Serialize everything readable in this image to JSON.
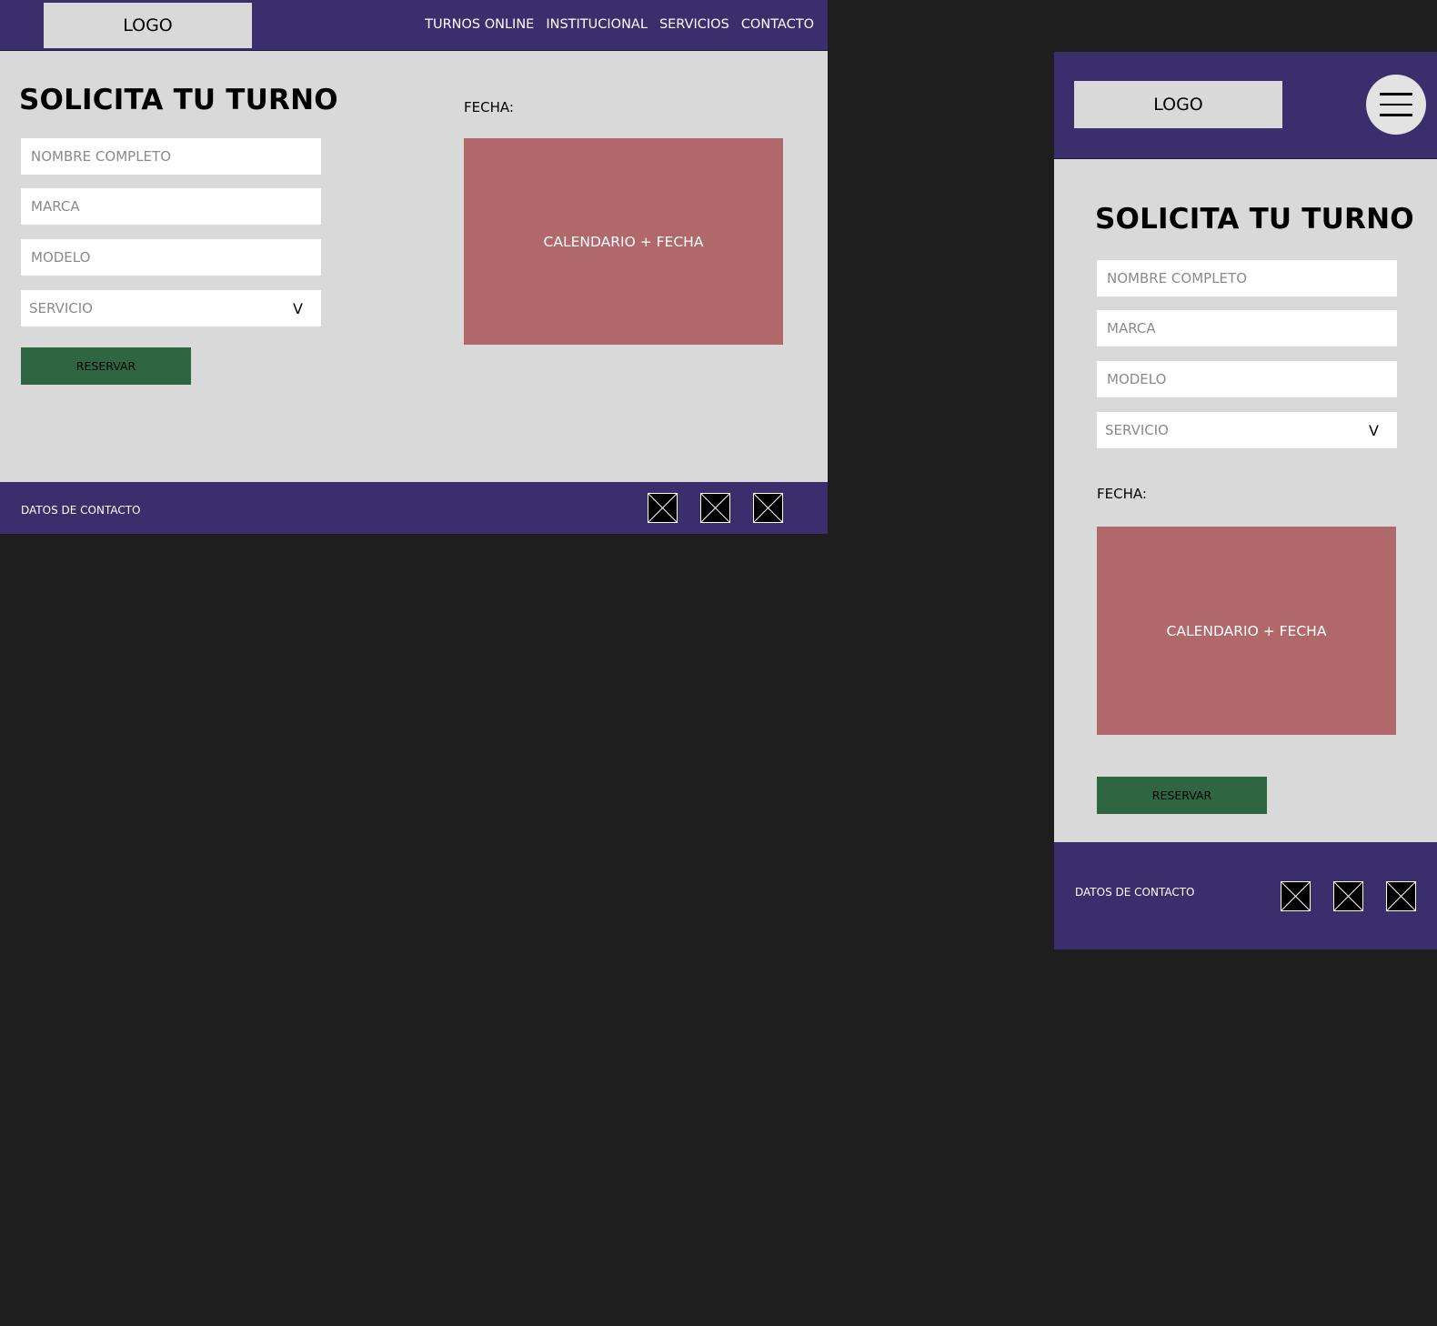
{
  "desktop": {
    "logo": "LOGO",
    "nav": [
      {
        "label": "TURNOS ONLINE"
      },
      {
        "label": "INSTITUCIONAL"
      },
      {
        "label": "SERVICIOS"
      },
      {
        "label": "CONTACTO"
      }
    ],
    "title": "SOLICITA TU TURNO",
    "fields": {
      "nombre_placeholder": "NOMBRE COMPLETO",
      "marca_placeholder": "MARCA",
      "modelo_placeholder": "MODELO"
    },
    "servicio": {
      "placeholder": "SERVICIO",
      "chevron": "V"
    },
    "reservar_label": "RESERVAR",
    "fecha_label": "FECHA:",
    "calendar_label": "CALENDARIO + FECHA",
    "footer": {
      "contact": "DATOS DE CONTACTO"
    }
  },
  "mobile": {
    "logo": "LOGO",
    "title": "SOLICITA TU TURNO",
    "fields": {
      "nombre_placeholder": "NOMBRE COMPLETO",
      "marca_placeholder": "MARCA",
      "modelo_placeholder": "MODELO"
    },
    "servicio": {
      "placeholder": "SERVICIO",
      "chevron": "V"
    },
    "fecha_label": "FECHA:",
    "calendar_label": "CALENDARIO + FECHA",
    "reservar_label": "RESERVAR",
    "footer": {
      "contact": "DATOS DE CONTACTO"
    }
  },
  "icons": {
    "menu": "hamburger-menu-icon",
    "social": "image-placeholder-icon"
  },
  "colors": {
    "header_bg": "#3a2e6d",
    "page_bg": "#d9d9d9",
    "canvas_bg": "#1e1e1e",
    "button_bg": "#2d6641",
    "calendar_bg": "#b1686a"
  }
}
